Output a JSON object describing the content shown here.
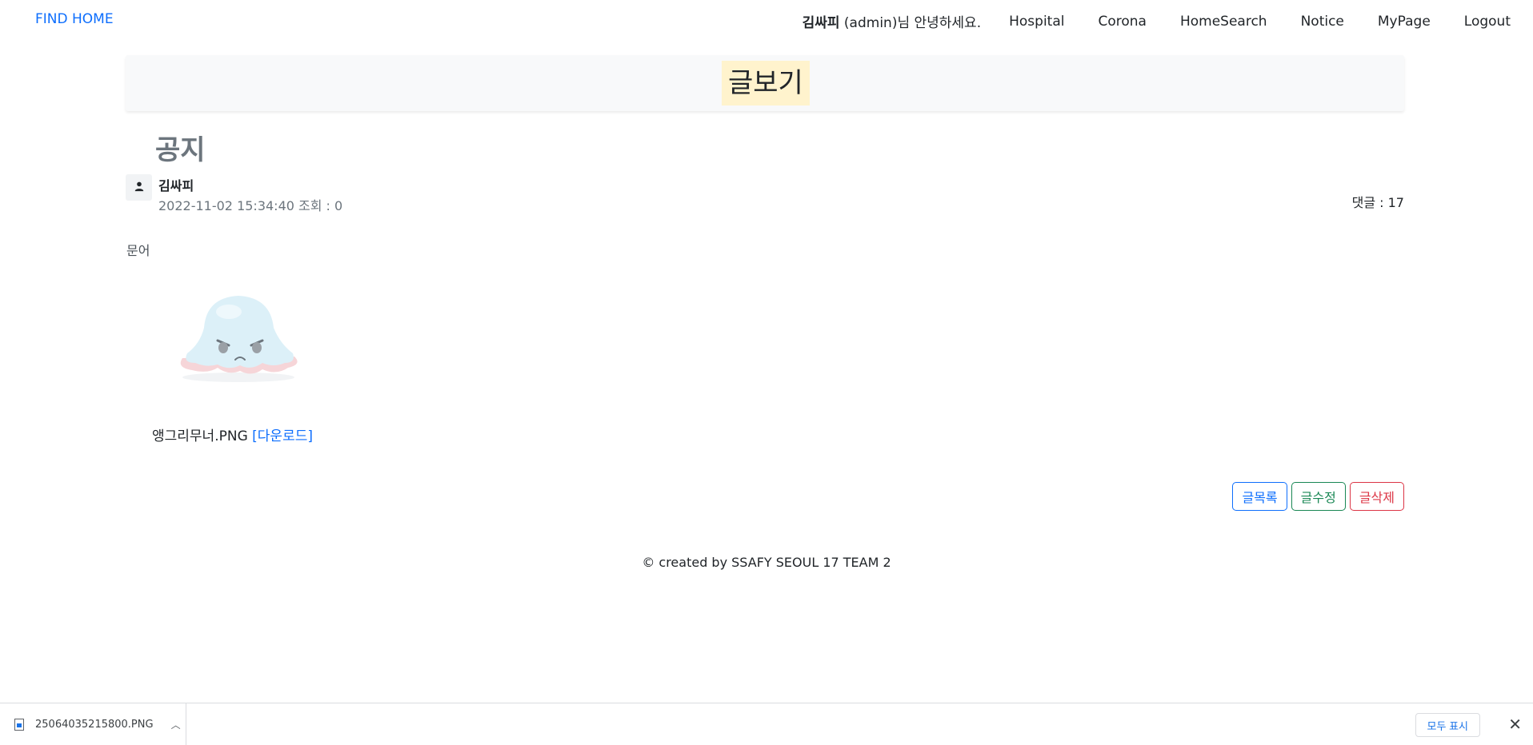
{
  "navbar": {
    "brand": "FIND HOME",
    "user_name": "김싸피",
    "greeting_suffix": " (admin)님 안녕하세요.",
    "links": [
      "Hospital",
      "Corona",
      "HomeSearch",
      "Notice",
      "MyPage",
      "Logout"
    ]
  },
  "page": {
    "title": "글보기"
  },
  "post": {
    "subject": "공지",
    "author": "김싸피",
    "meta": "2022-11-02 15:34:40 조회 : 0",
    "comment_count": "댓글 : 17",
    "content": "문어",
    "attachment": {
      "file_name": "앵그리무너.PNG",
      "download_label": "[다운로드]"
    }
  },
  "actions": {
    "list_label": "글목록",
    "edit_label": "글수정",
    "delete_label": "글삭제"
  },
  "footer": {
    "text": "© created by SSAFY SEOUL 17 TEAM 2"
  },
  "download_bar": {
    "file_name": "25064035215800.PNG",
    "show_all_label": "모두 표시"
  },
  "colors": {
    "primary": "#0d6efd",
    "success": "#198754",
    "danger": "#dc3545",
    "title_highlight": "#fff3cd"
  },
  "icons": [
    "person-icon",
    "file-icon",
    "chevron-up-icon",
    "close-icon",
    "octopus-plush-image"
  ]
}
